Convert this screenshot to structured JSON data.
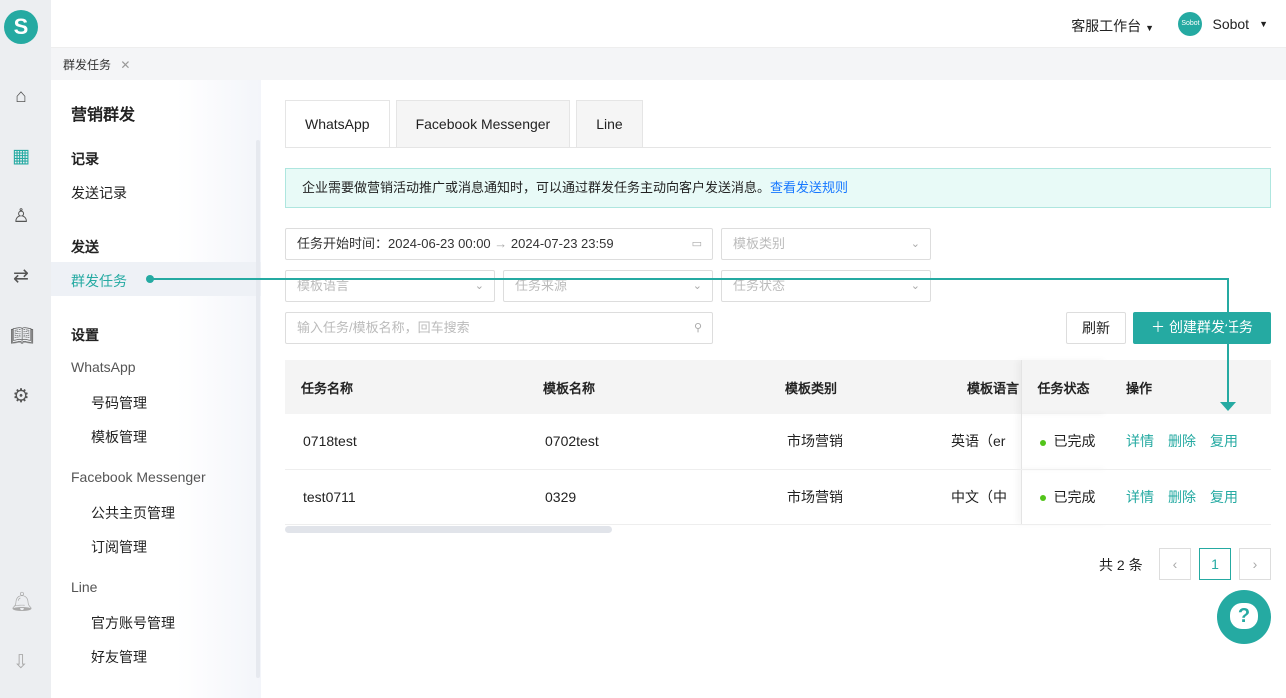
{
  "header": {
    "workspace": "客服工作台",
    "user": "Sobot",
    "avatar_text": "Sobot",
    "logo": "S"
  },
  "open_tab": "群发任务",
  "sidebar": {
    "title": "营销群发",
    "sec_record": "记录",
    "send_log": "发送记录",
    "sec_send": "发送",
    "mass_task": "群发任务",
    "sec_settings": "设置",
    "whatsapp": "WhatsApp",
    "numbers": "号码管理",
    "templates": "模板管理",
    "fb": "Facebook Messenger",
    "pages": "公共主页管理",
    "subs": "订阅管理",
    "line": "Line",
    "official": "官方账号管理",
    "friends": "好友管理"
  },
  "tabs": [
    "WhatsApp",
    "Facebook Messenger",
    "Line"
  ],
  "notice": {
    "text": "企业需要做营销活动推广或消息通知时，可以通过群发任务主动向客户发送消息。",
    "link": "查看发送规则"
  },
  "filters": {
    "date_label": "任务开始时间：",
    "date_start": "2024-06-23 00:00",
    "date_end": "2024-07-23 23:59",
    "template_type": "模板类别",
    "template_lang": "模板语言",
    "task_source": "任务来源",
    "task_status": "任务状态",
    "search_placeholder": "输入任务/模板名称，回车搜索"
  },
  "buttons": {
    "refresh": "刷新",
    "create": "创建群发任务"
  },
  "table": {
    "headers": [
      "任务名称",
      "模板名称",
      "模板类别",
      "模板语言",
      "任务状态",
      "操作"
    ],
    "rows": [
      {
        "name": "0718test",
        "template": "0702test",
        "type": "市场营销",
        "lang": "英语（er",
        "status": "已完成"
      },
      {
        "name": "test0711",
        "template": "0329",
        "type": "市场营销",
        "lang": "中文（中",
        "status": "已完成"
      }
    ],
    "actions": [
      "详情",
      "删除",
      "复用"
    ]
  },
  "pagination": {
    "total": "共 2 条",
    "page": "1"
  },
  "colors": {
    "accent": "#25aaa2",
    "status_done": "#52c41a"
  }
}
